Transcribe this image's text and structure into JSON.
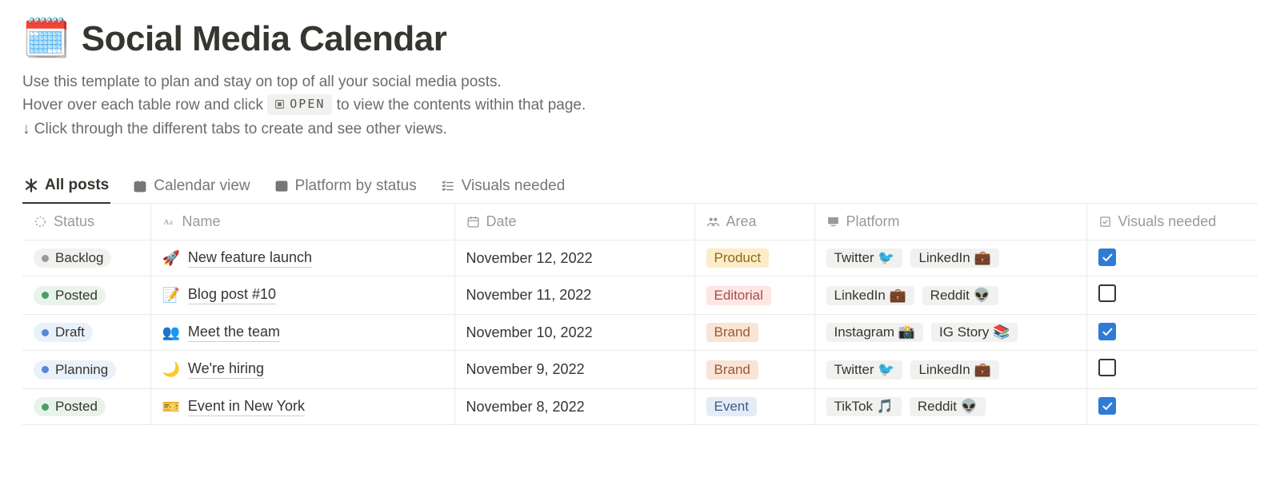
{
  "page": {
    "emoji": "🗓️",
    "title": "Social Media Calendar",
    "desc_line1": "Use this template to plan and stay on top of all your social media posts.",
    "desc_line2_a": "Hover over each table row and click ",
    "desc_open_label": "OPEN",
    "desc_line2_b": " to view the contents within that page.",
    "desc_line3": "↓ Click through the different tabs to create and see other views."
  },
  "tabs": [
    {
      "label": "All posts"
    },
    {
      "label": "Calendar view"
    },
    {
      "label": "Platform by status"
    },
    {
      "label": "Visuals needed"
    }
  ],
  "columns": {
    "status": "Status",
    "name": "Name",
    "date": "Date",
    "area": "Area",
    "platform": "Platform",
    "visuals": "Visuals needed"
  },
  "status_styles": {
    "Backlog": {
      "bg": "#f1f1ef",
      "dot": "#9b9a97"
    },
    "Posted": {
      "bg": "#e8f3ea",
      "dot": "#4f9e66"
    },
    "Draft": {
      "bg": "#e9f1fb",
      "dot": "#5a87d6"
    },
    "Planning": {
      "bg": "#e9f1fb",
      "dot": "#5a87d6"
    }
  },
  "area_styles": {
    "Product": {
      "bg": "#fdecc8",
      "fg": "#8a6a1f"
    },
    "Editorial": {
      "bg": "#fde6e3",
      "fg": "#a05050"
    },
    "Brand": {
      "bg": "#f9e4d6",
      "fg": "#9a5b34"
    },
    "Event": {
      "bg": "#e4ecf6",
      "fg": "#3a5e8c"
    }
  },
  "rows": [
    {
      "status": "Backlog",
      "emoji": "🚀",
      "name": "New feature launch",
      "date": "November 12, 2022",
      "area": "Product",
      "platforms": [
        "Twitter 🐦",
        "LinkedIn 💼"
      ],
      "visuals": true
    },
    {
      "status": "Posted",
      "emoji": "📝",
      "name": "Blog post #10",
      "date": "November 11, 2022",
      "area": "Editorial",
      "platforms": [
        "LinkedIn 💼",
        "Reddit 👽"
      ],
      "visuals": false
    },
    {
      "status": "Draft",
      "emoji": "👥",
      "name": "Meet the team",
      "date": "November 10, 2022",
      "area": "Brand",
      "platforms": [
        "Instagram 📸",
        "IG Story 📚"
      ],
      "visuals": true
    },
    {
      "status": "Planning",
      "emoji": "🌙",
      "name": "We're hiring",
      "date": "November 9, 2022",
      "area": "Brand",
      "platforms": [
        "Twitter 🐦",
        "LinkedIn 💼"
      ],
      "visuals": false
    },
    {
      "status": "Posted",
      "emoji": "🎫",
      "name": "Event in New York",
      "date": "November 8, 2022",
      "area": "Event",
      "platforms": [
        "TikTok 🎵",
        "Reddit 👽"
      ],
      "visuals": true
    }
  ]
}
